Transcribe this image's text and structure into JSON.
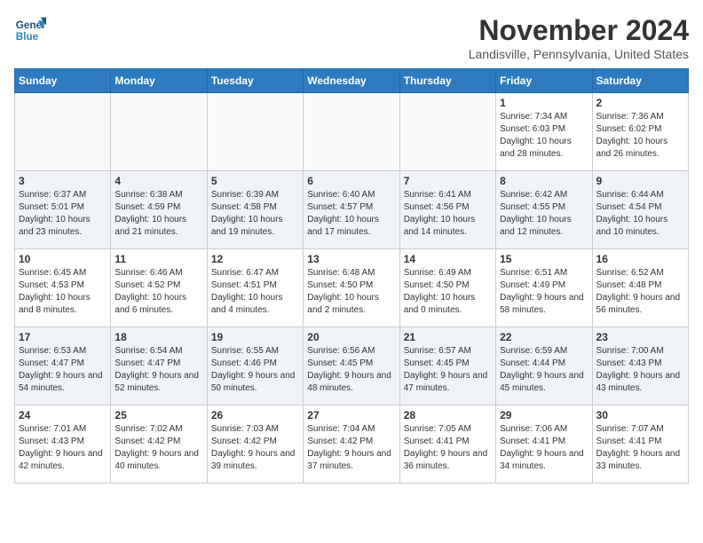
{
  "header": {
    "logo_line1": "General",
    "logo_line2": "Blue",
    "month": "November 2024",
    "location": "Landisville, Pennsylvania, United States"
  },
  "weekdays": [
    "Sunday",
    "Monday",
    "Tuesday",
    "Wednesday",
    "Thursday",
    "Friday",
    "Saturday"
  ],
  "weeks": [
    [
      {
        "day": "",
        "empty": true
      },
      {
        "day": "",
        "empty": true
      },
      {
        "day": "",
        "empty": true
      },
      {
        "day": "",
        "empty": true
      },
      {
        "day": "",
        "empty": true
      },
      {
        "day": "1",
        "sunrise": "Sunrise: 7:34 AM",
        "sunset": "Sunset: 6:03 PM",
        "daylight": "Daylight: 10 hours and 28 minutes."
      },
      {
        "day": "2",
        "sunrise": "Sunrise: 7:36 AM",
        "sunset": "Sunset: 6:02 PM",
        "daylight": "Daylight: 10 hours and 26 minutes."
      }
    ],
    [
      {
        "day": "3",
        "sunrise": "Sunrise: 6:37 AM",
        "sunset": "Sunset: 5:01 PM",
        "daylight": "Daylight: 10 hours and 23 minutes."
      },
      {
        "day": "4",
        "sunrise": "Sunrise: 6:38 AM",
        "sunset": "Sunset: 4:59 PM",
        "daylight": "Daylight: 10 hours and 21 minutes."
      },
      {
        "day": "5",
        "sunrise": "Sunrise: 6:39 AM",
        "sunset": "Sunset: 4:58 PM",
        "daylight": "Daylight: 10 hours and 19 minutes."
      },
      {
        "day": "6",
        "sunrise": "Sunrise: 6:40 AM",
        "sunset": "Sunset: 4:57 PM",
        "daylight": "Daylight: 10 hours and 17 minutes."
      },
      {
        "day": "7",
        "sunrise": "Sunrise: 6:41 AM",
        "sunset": "Sunset: 4:56 PM",
        "daylight": "Daylight: 10 hours and 14 minutes."
      },
      {
        "day": "8",
        "sunrise": "Sunrise: 6:42 AM",
        "sunset": "Sunset: 4:55 PM",
        "daylight": "Daylight: 10 hours and 12 minutes."
      },
      {
        "day": "9",
        "sunrise": "Sunrise: 6:44 AM",
        "sunset": "Sunset: 4:54 PM",
        "daylight": "Daylight: 10 hours and 10 minutes."
      }
    ],
    [
      {
        "day": "10",
        "sunrise": "Sunrise: 6:45 AM",
        "sunset": "Sunset: 4:53 PM",
        "daylight": "Daylight: 10 hours and 8 minutes."
      },
      {
        "day": "11",
        "sunrise": "Sunrise: 6:46 AM",
        "sunset": "Sunset: 4:52 PM",
        "daylight": "Daylight: 10 hours and 6 minutes."
      },
      {
        "day": "12",
        "sunrise": "Sunrise: 6:47 AM",
        "sunset": "Sunset: 4:51 PM",
        "daylight": "Daylight: 10 hours and 4 minutes."
      },
      {
        "day": "13",
        "sunrise": "Sunrise: 6:48 AM",
        "sunset": "Sunset: 4:50 PM",
        "daylight": "Daylight: 10 hours and 2 minutes."
      },
      {
        "day": "14",
        "sunrise": "Sunrise: 6:49 AM",
        "sunset": "Sunset: 4:50 PM",
        "daylight": "Daylight: 10 hours and 0 minutes."
      },
      {
        "day": "15",
        "sunrise": "Sunrise: 6:51 AM",
        "sunset": "Sunset: 4:49 PM",
        "daylight": "Daylight: 9 hours and 58 minutes."
      },
      {
        "day": "16",
        "sunrise": "Sunrise: 6:52 AM",
        "sunset": "Sunset: 4:48 PM",
        "daylight": "Daylight: 9 hours and 56 minutes."
      }
    ],
    [
      {
        "day": "17",
        "sunrise": "Sunrise: 6:53 AM",
        "sunset": "Sunset: 4:47 PM",
        "daylight": "Daylight: 9 hours and 54 minutes."
      },
      {
        "day": "18",
        "sunrise": "Sunrise: 6:54 AM",
        "sunset": "Sunset: 4:47 PM",
        "daylight": "Daylight: 9 hours and 52 minutes."
      },
      {
        "day": "19",
        "sunrise": "Sunrise: 6:55 AM",
        "sunset": "Sunset: 4:46 PM",
        "daylight": "Daylight: 9 hours and 50 minutes."
      },
      {
        "day": "20",
        "sunrise": "Sunrise: 6:56 AM",
        "sunset": "Sunset: 4:45 PM",
        "daylight": "Daylight: 9 hours and 48 minutes."
      },
      {
        "day": "21",
        "sunrise": "Sunrise: 6:57 AM",
        "sunset": "Sunset: 4:45 PM",
        "daylight": "Daylight: 9 hours and 47 minutes."
      },
      {
        "day": "22",
        "sunrise": "Sunrise: 6:59 AM",
        "sunset": "Sunset: 4:44 PM",
        "daylight": "Daylight: 9 hours and 45 minutes."
      },
      {
        "day": "23",
        "sunrise": "Sunrise: 7:00 AM",
        "sunset": "Sunset: 4:43 PM",
        "daylight": "Daylight: 9 hours and 43 minutes."
      }
    ],
    [
      {
        "day": "24",
        "sunrise": "Sunrise: 7:01 AM",
        "sunset": "Sunset: 4:43 PM",
        "daylight": "Daylight: 9 hours and 42 minutes."
      },
      {
        "day": "25",
        "sunrise": "Sunrise: 7:02 AM",
        "sunset": "Sunset: 4:42 PM",
        "daylight": "Daylight: 9 hours and 40 minutes."
      },
      {
        "day": "26",
        "sunrise": "Sunrise: 7:03 AM",
        "sunset": "Sunset: 4:42 PM",
        "daylight": "Daylight: 9 hours and 39 minutes."
      },
      {
        "day": "27",
        "sunrise": "Sunrise: 7:04 AM",
        "sunset": "Sunset: 4:42 PM",
        "daylight": "Daylight: 9 hours and 37 minutes."
      },
      {
        "day": "28",
        "sunrise": "Sunrise: 7:05 AM",
        "sunset": "Sunset: 4:41 PM",
        "daylight": "Daylight: 9 hours and 36 minutes."
      },
      {
        "day": "29",
        "sunrise": "Sunrise: 7:06 AM",
        "sunset": "Sunset: 4:41 PM",
        "daylight": "Daylight: 9 hours and 34 minutes."
      },
      {
        "day": "30",
        "sunrise": "Sunrise: 7:07 AM",
        "sunset": "Sunset: 4:41 PM",
        "daylight": "Daylight: 9 hours and 33 minutes."
      }
    ]
  ]
}
